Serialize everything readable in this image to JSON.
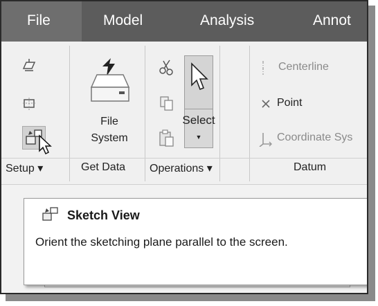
{
  "tabs": [
    {
      "label": "File"
    },
    {
      "label": "Model"
    },
    {
      "label": "Analysis"
    },
    {
      "label": "Annot"
    }
  ],
  "ribbon": {
    "file_system_label_line1": "File",
    "file_system_label_line2": "System",
    "select_label": "Select",
    "select_arrow": "▼",
    "datum": {
      "centerline_label": "Centerline",
      "point_label": "Point",
      "coordinate_system_label": "Coordinate Sys"
    },
    "groups": {
      "setup": "Setup ▾",
      "get_data": "Get Data",
      "operations": "Operations ▾",
      "datum": "Datum"
    }
  },
  "tooltip": {
    "title": "Sketch View",
    "description": "Orient the sketching plane parallel to the screen."
  },
  "colors": {
    "tab_bar": "#5c5c5c",
    "active_tab": "#6e6e6e",
    "ribbon_bg": "#f0f0f0",
    "select_highlight": "#d4d4d4"
  },
  "icons": [
    "sketch-setup-icon",
    "sketch-plane-icon",
    "sketch-view-icon",
    "mouse-pointer-icon",
    "file-system-icon",
    "cut-icon",
    "copy-icon",
    "paste-icon",
    "select-arrow-icon",
    "centerline-icon",
    "point-icon",
    "coordinate-system-icon",
    "sketch-view-tooltip-icon"
  ]
}
